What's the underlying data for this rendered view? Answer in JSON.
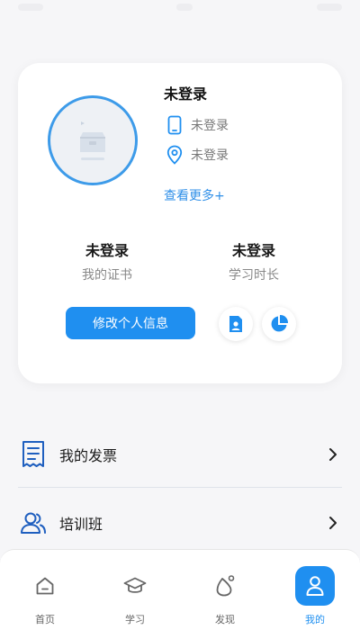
{
  "profile": {
    "name": "未登录",
    "phone": "未登录",
    "location": "未登录",
    "see_more": "查看更多+",
    "avatar_icon": "placeholder-image-icon",
    "stats": [
      {
        "value": "未登录",
        "label": "我的证书"
      },
      {
        "value": "未登录",
        "label": "学习时长"
      }
    ],
    "edit_label": "修改个人信息",
    "actions": [
      {
        "icon": "id-card-icon"
      },
      {
        "icon": "pie-chart-icon"
      }
    ]
  },
  "menu": {
    "items": [
      {
        "label": "我的发票",
        "icon": "invoice-icon"
      },
      {
        "label": "培训班",
        "icon": "group-users-icon"
      }
    ]
  },
  "tabbar": {
    "items": [
      {
        "label": "首页",
        "icon": "home-icon"
      },
      {
        "label": "学习",
        "icon": "graduation-cap-icon"
      },
      {
        "label": "发现",
        "icon": "discover-icon"
      },
      {
        "label": "我的",
        "icon": "user-icon"
      }
    ],
    "active_index": 3
  },
  "colors": {
    "accent": "#1f8ff0",
    "background": "#f6f6f8",
    "card": "#ffffff",
    "muted_text": "#777777"
  }
}
